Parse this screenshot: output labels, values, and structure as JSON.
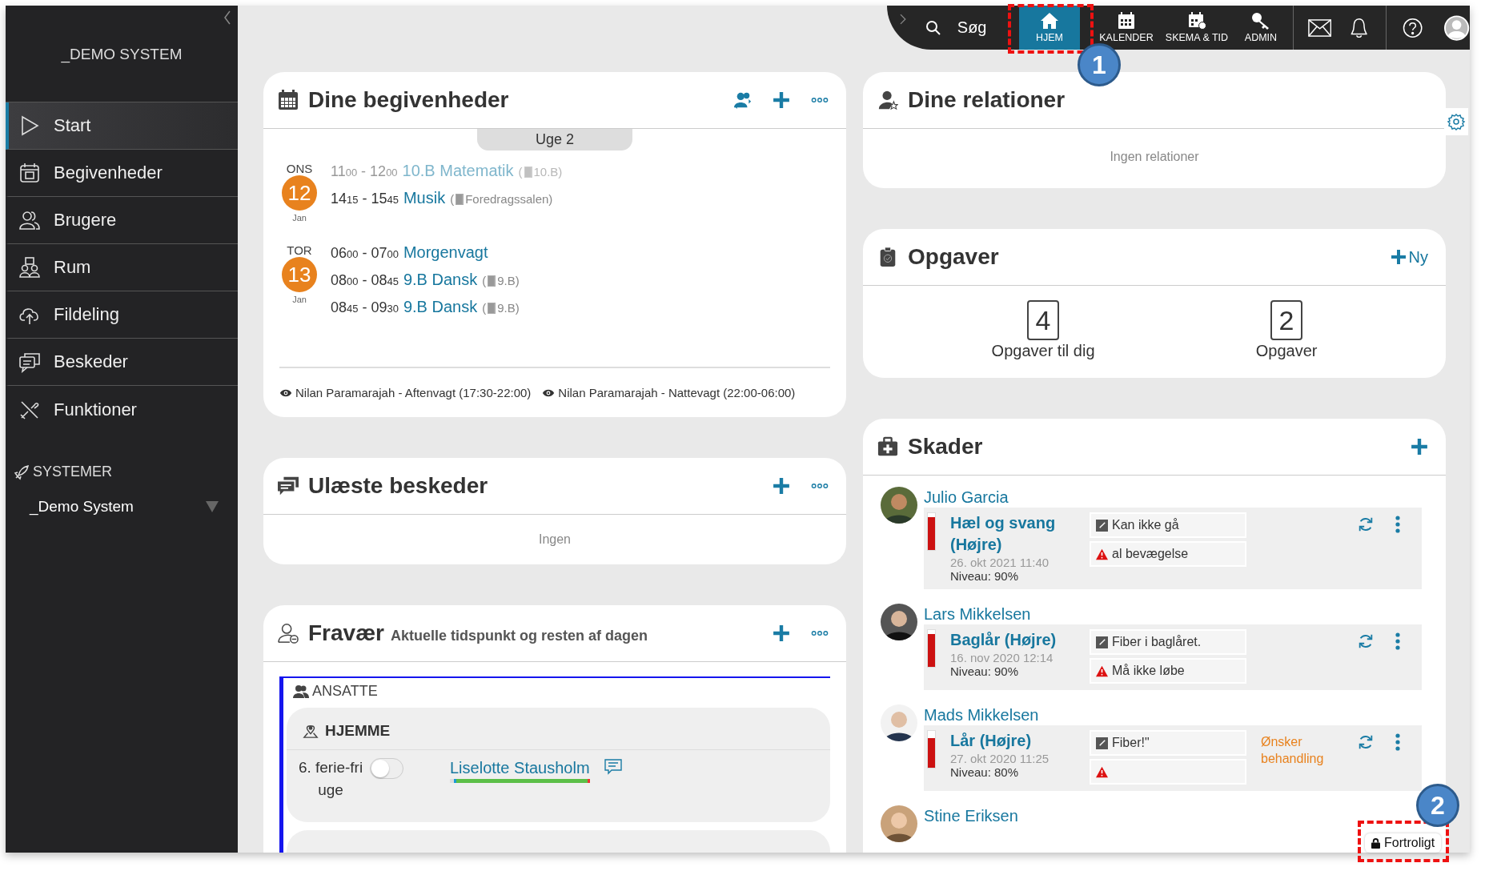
{
  "sidebar": {
    "system_title": "_DEMO SYSTEM",
    "items": [
      {
        "label": "Start",
        "selected": true
      },
      {
        "label": "Begivenheder",
        "selected": false
      },
      {
        "label": "Brugere",
        "selected": false
      },
      {
        "label": "Rum",
        "selected": false
      },
      {
        "label": "Fildeling",
        "selected": false
      },
      {
        "label": "Beskeder",
        "selected": false
      },
      {
        "label": "Funktioner",
        "selected": false
      }
    ],
    "section_label": "SYSTEMER",
    "system_select": "_Demo System"
  },
  "topbar": {
    "search_label": "Søg",
    "nav": [
      {
        "label": "HJEM",
        "selected": true,
        "callout": "1"
      },
      {
        "label": "KALENDER",
        "selected": false
      },
      {
        "label": "SKEMA & TID",
        "selected": false
      },
      {
        "label": "ADMIN",
        "selected": false
      }
    ]
  },
  "events": {
    "title": "Dine begivenheder",
    "week": "Uge 2",
    "days": [
      {
        "weekday": "ONS",
        "date": "12",
        "month": "Jan",
        "events": [
          {
            "time": "11$_{00}$ - 12$_{00}$",
            "title": "10.B Matematik",
            "room_open": "(",
            "room": "10.B)",
            "past": true
          },
          {
            "time": "14$_{15}$ - 15$_{45}$",
            "title": "Musik",
            "room_open": "(",
            "room": "Foredragssalen)",
            "past": false
          }
        ]
      },
      {
        "weekday": "TOR",
        "date": "13",
        "month": "Jan",
        "events": [
          {
            "time": "06$_{00}$ - 07$_{00}$",
            "title": "Morgenvagt",
            "past": false
          },
          {
            "time": "08$_{00}$ - 08$_{45}$",
            "title": "9.B Dansk",
            "room_open": "(",
            "room": "9.B)",
            "past": false
          },
          {
            "time": "08$_{45}$ - 09$_{30}$",
            "title": "9.B Dansk",
            "room_open": "(",
            "room": "9.B)",
            "past": false
          }
        ]
      }
    ],
    "footer": [
      "Nilan Paramarajah - Aftenvagt (17:30-22:00)",
      "Nilan Paramarajah - Nattevagt (22:00-06:00)"
    ]
  },
  "messages": {
    "title": "Ulæste beskeder",
    "empty": "Ingen"
  },
  "absence": {
    "title": "Fravær",
    "subtitle": "Aktuelle tidspunkt og resten af dagen",
    "section": "ANSATTE",
    "groups": [
      {
        "title": "HJEMME",
        "rows": [
          {
            "label": "6. ferie-fri uge",
            "on": false,
            "name": "Liselotte Stausholm",
            "level": 0.97
          }
        ]
      }
    ]
  },
  "relations": {
    "title": "Dine relationer",
    "empty": "Ingen relationer"
  },
  "tasks": {
    "title": "Opgaver",
    "new_label": "Ny",
    "counters": [
      {
        "count": "4",
        "label": "Opgaver til dig"
      },
      {
        "count": "2",
        "label": "Opgaver"
      }
    ]
  },
  "injuries": {
    "title": "Skader",
    "entries": [
      {
        "name": "Julio Garcia",
        "injury": "Hæl og svang (Højre)",
        "date": "26. okt 2021 11:40",
        "level_text": "Niveau: 90%",
        "level": 0.9,
        "notes": [
          {
            "kind": "note",
            "text": "Kan ikke gå"
          },
          {
            "kind": "warning",
            "text": "al bevægelse"
          }
        ]
      },
      {
        "name": "Lars Mikkelsen",
        "injury": "Baglår (Højre)",
        "date": "16. nov 2020 12:14",
        "level_text": "Niveau: 90%",
        "level": 0.9,
        "notes": [
          {
            "kind": "note",
            "text": "Fiber i baglåret."
          },
          {
            "kind": "warning",
            "text": "Må ikke løbe"
          }
        ]
      },
      {
        "name": "Mads Mikkelsen",
        "injury": "Lår (Højre)",
        "date": "27. okt 2020 11:25",
        "level_text": "Niveau: 80%",
        "level": 0.8,
        "status": "Ønsker behandling",
        "notes": [
          {
            "kind": "note",
            "text": "Fiber!\""
          },
          {
            "kind": "warning"
          }
        ]
      },
      {
        "name": "Stine Eriksen"
      }
    ],
    "confidential": {
      "label": "Fortroligt",
      "callout": "2"
    }
  }
}
